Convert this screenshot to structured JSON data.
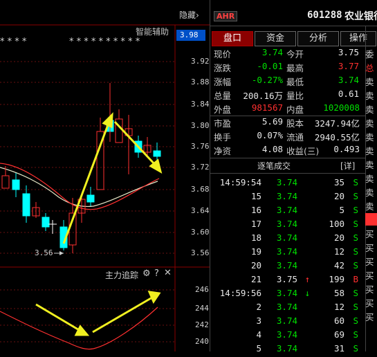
{
  "chart": {
    "header_label": "智能辅助",
    "stars": "* * * *",
    "stars2": "* * * * * * * * * *",
    "current_price_tag": "3.98",
    "y_ticks": [
      "3.92",
      "3.88",
      "3.84",
      "3.80",
      "3.76",
      "3.72",
      "3.68",
      "3.64",
      "3.60",
      "3.56"
    ],
    "low_marker": "3.56",
    "indicator_title": "主力追踪",
    "indicator_icons": [
      "gear-icon",
      "help-icon",
      "close-icon"
    ],
    "indicator_y_ticks": [
      "246",
      "244",
      "242",
      "240"
    ]
  },
  "header": {
    "hide_label": "隐藏",
    "hide_arrow": "›",
    "market_tag": "AHR",
    "stock_code": "601288",
    "stock_name": "农业银行"
  },
  "tabs": [
    {
      "label": "盘口",
      "active": true
    },
    {
      "label": "资金",
      "active": false
    },
    {
      "label": "分析",
      "active": false
    },
    {
      "label": "操作",
      "active": false
    }
  ],
  "quote": {
    "rows": [
      {
        "l1": "现价",
        "v1": "3.74",
        "c1": "green",
        "l2": "今开",
        "v2": "3.75",
        "c2": "white"
      },
      {
        "l1": "涨跌",
        "v1": "-0.01",
        "c1": "green",
        "l2": "最高",
        "v2": "3.77",
        "c2": "red"
      },
      {
        "l1": "涨幅",
        "v1": "-0.27%",
        "c1": "green",
        "l2": "最低",
        "v2": "3.74",
        "c2": "green"
      },
      {
        "l1": "总量",
        "v1": "200.16万",
        "c1": "white",
        "l2": "量比",
        "v2": "0.61",
        "c2": "white"
      },
      {
        "l1": "外盘",
        "v1": "981567",
        "c1": "red",
        "l2": "内盘",
        "v2": "1020008",
        "c2": "green"
      }
    ],
    "rows2": [
      {
        "l1": "市盈",
        "v1": "5.69",
        "l2": "股本",
        "v2": "3247.94亿"
      },
      {
        "l1": "换手",
        "v1": "0.07%",
        "l2": "流通",
        "v2": "2940.55亿"
      },
      {
        "l1": "净资",
        "v1": "4.08",
        "l2": "收益(三)",
        "v2": "0.493"
      }
    ]
  },
  "trades_header": {
    "title": "逐笔成交",
    "detail": "[详]"
  },
  "trades": [
    {
      "time": "14:59:54",
      "price": "3.74",
      "pc": "green",
      "arrow": "",
      "vol": "35",
      "flag": "S",
      "fc": "green"
    },
    {
      "time": "15",
      "price": "3.74",
      "pc": "green",
      "arrow": "",
      "vol": "20",
      "flag": "S",
      "fc": "green"
    },
    {
      "time": "16",
      "price": "3.74",
      "pc": "green",
      "arrow": "",
      "vol": "5",
      "flag": "S",
      "fc": "green"
    },
    {
      "time": "17",
      "price": "3.74",
      "pc": "green",
      "arrow": "",
      "vol": "100",
      "flag": "S",
      "fc": "green"
    },
    {
      "time": "18",
      "price": "3.74",
      "pc": "green",
      "arrow": "",
      "vol": "20",
      "flag": "S",
      "fc": "green"
    },
    {
      "time": "19",
      "price": "3.74",
      "pc": "green",
      "arrow": "",
      "vol": "12",
      "flag": "S",
      "fc": "green"
    },
    {
      "time": "20",
      "price": "3.74",
      "pc": "green",
      "arrow": "",
      "vol": "42",
      "flag": "S",
      "fc": "green"
    },
    {
      "time": "21",
      "price": "3.75",
      "pc": "white",
      "arrow": "↑",
      "vol": "199",
      "flag": "B",
      "fc": "red"
    },
    {
      "time": "14:59:56",
      "price": "3.74",
      "pc": "green",
      "arrow": "↓",
      "vol": "58",
      "flag": "S",
      "fc": "green"
    },
    {
      "time": "2",
      "price": "3.74",
      "pc": "green",
      "arrow": "",
      "vol": "12",
      "flag": "S",
      "fc": "green"
    },
    {
      "time": "3",
      "price": "3.74",
      "pc": "green",
      "arrow": "",
      "vol": "60",
      "flag": "S",
      "fc": "green"
    },
    {
      "time": "4",
      "price": "3.74",
      "pc": "green",
      "arrow": "",
      "vol": "69",
      "flag": "S",
      "fc": "green"
    },
    {
      "time": "5",
      "price": "3.74",
      "pc": "green",
      "arrow": "",
      "vol": "31",
      "flag": "S",
      "fc": "green"
    }
  ],
  "side_column": [
    "委",
    "总",
    "卖",
    "卖",
    "卖",
    "卖",
    "卖",
    "卖",
    "卖",
    "卖",
    "卖",
    "卖",
    "买",
    "买",
    "买",
    "买",
    "买",
    "买",
    "买",
    "买"
  ]
}
